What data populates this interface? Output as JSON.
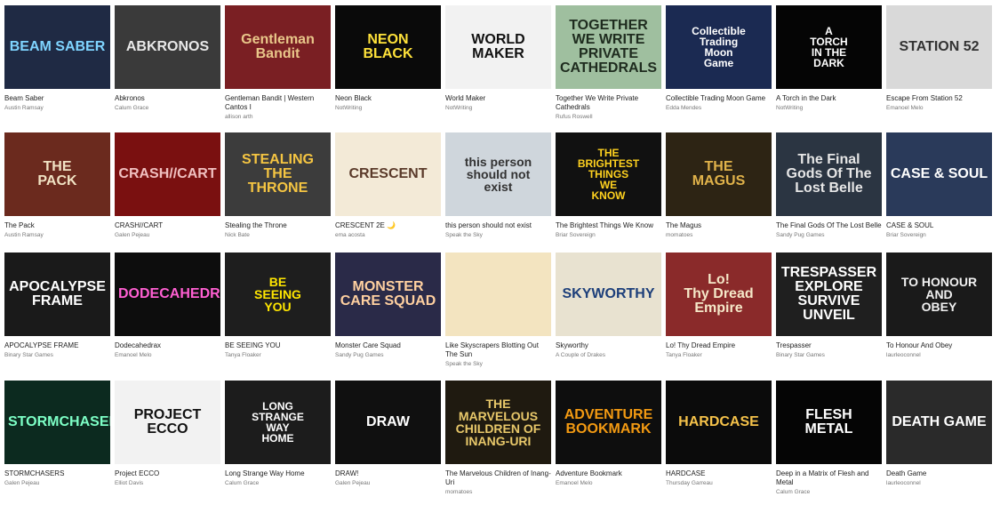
{
  "games": [
    {
      "title": "Beam Saber",
      "author": "Austin Ramsay",
      "art": "BEAM SABER",
      "bg": "#1f2a44",
      "fg": "#7fd4ff"
    },
    {
      "title": "Abkronos",
      "author": "Calum Grace",
      "art": "ABKRONOS",
      "bg": "#3a3a3a",
      "fg": "#e8e8e8"
    },
    {
      "title": "Gentleman Bandit | Western Cantos I",
      "author": "allison arth",
      "art": "Gentleman\nBandit",
      "bg": "#7a1f23",
      "fg": "#e9c78a"
    },
    {
      "title": "Neon Black",
      "author": "NotWriting",
      "art": "NEON\nBLACK",
      "bg": "#0a0a0a",
      "fg": "#ffe23a"
    },
    {
      "title": "World Maker",
      "author": "NotWriting",
      "art": "WORLD\nMAKER",
      "bg": "#f2f2f2",
      "fg": "#111111"
    },
    {
      "title": "Together We Write Private Cathedrals",
      "author": "Rufus Roswell",
      "art": "TOGETHER WE WRITE\nPRIVATE CATHEDRALS",
      "bg": "#9fbf9f",
      "fg": "#1e2b1e"
    },
    {
      "title": "Collectible Trading Moon Game",
      "author": "Edda Mendes",
      "art": "Collectible\nTrading\nMoon\nGame",
      "bg": "#1b2a52",
      "fg": "#ffffff"
    },
    {
      "title": "A Torch in the Dark",
      "author": "NotWriting",
      "art": "A\nTORCH\nIN THE\nDARK",
      "bg": "#050505",
      "fg": "#ffffff"
    },
    {
      "title": "Escape From Station 52",
      "author": "Emanoel Melo",
      "art": "STATION 52",
      "bg": "#d9d9d9",
      "fg": "#333333"
    },
    {
      "title": "The Pack",
      "author": "Austin Ramsay",
      "art": "THE\nPACK",
      "bg": "#6b2a1e",
      "fg": "#f1e3c4"
    },
    {
      "title": "CRASH//CART",
      "author": "Galen Pejeau",
      "art": "CRASH//CART",
      "bg": "#7a1010",
      "fg": "#f0c0c0"
    },
    {
      "title": "Stealing the Throne",
      "author": "Nick Bate",
      "art": "STEALING THE\nTHRONE",
      "bg": "#3c3c3c",
      "fg": "#f5c542"
    },
    {
      "title": "CRESCENT 2E 🌙",
      "author": "ema acosta",
      "art": "CRESCENT",
      "bg": "#f3ead7",
      "fg": "#5a3a2a"
    },
    {
      "title": "this person should not exist",
      "author": "Speak the Sky",
      "art": "this person\nshould not\nexist",
      "bg": "#cfd6dc",
      "fg": "#333333"
    },
    {
      "title": "The Brightest Things We Know",
      "author": "Briar Sovereign",
      "art": "THE\nBRIGHTEST\nTHINGS\nWE\nKNOW",
      "bg": "#111111",
      "fg": "#ffd21f"
    },
    {
      "title": "The Magus",
      "author": "momatoes",
      "art": "THE\nMAGUS",
      "bg": "#2d2414",
      "fg": "#e0b24a"
    },
    {
      "title": "The Final Gods Of The Lost Belle",
      "author": "Sandy Pug Games",
      "art": "The Final Gods Of The Lost Belle",
      "bg": "#2b3542",
      "fg": "#e6e6e6"
    },
    {
      "title": "CASE & SOUL",
      "author": "Briar Sovereign",
      "art": "CASE & SOUL",
      "bg": "#2a3a5a",
      "fg": "#ffffff"
    },
    {
      "title": "APOCALYPSE FRAME",
      "author": "Binary Star Games",
      "art": "APOCALYPSE\nFRAME",
      "bg": "#1a1a1a",
      "fg": "#ffffff"
    },
    {
      "title": "Dodecahedrax",
      "author": "Emanoel Melo",
      "art": "DODECAHEDRAX",
      "bg": "#0d0d0d",
      "fg": "#ff5fd2"
    },
    {
      "title": "BE SEEING YOU",
      "author": "Tanya Floaker",
      "art": "BE\nSEEING\nYOU",
      "bg": "#1e1e1e",
      "fg": "#ffe600"
    },
    {
      "title": "Monster Care Squad",
      "author": "Sandy Pug Games",
      "art": "MONSTER CARE SQUAD",
      "bg": "#2a2a48",
      "fg": "#ffd0a0"
    },
    {
      "title": "Like Skyscrapers Blotting Out The Sun",
      "author": "Speak the Sky",
      "art": "",
      "bg": "#f3e4c0",
      "fg": "#b3201e"
    },
    {
      "title": "Skyworthy",
      "author": "A Couple of Drakes",
      "art": "SKYWORTHY",
      "bg": "#e8e2d0",
      "fg": "#1d3f7a"
    },
    {
      "title": "Lo! Thy Dread Empire",
      "author": "Tanya Floaker",
      "art": "Lo!\nThy Dread Empire",
      "bg": "#8a2a2a",
      "fg": "#f5e8c8"
    },
    {
      "title": "Trespasser",
      "author": "Binary Star Games",
      "art": "TRESPASSER\nEXPLORE  SURVIVE  UNVEIL",
      "bg": "#1f1f1f",
      "fg": "#ffffff"
    },
    {
      "title": "To Honour And Obey",
      "author": "laurleoconnel",
      "art": "TO HONOUR\nAND\nOBEY",
      "bg": "#1a1a1a",
      "fg": "#f0f0f0"
    },
    {
      "title": "STORMCHASERS",
      "author": "Galen Pejeau",
      "art": "STORMCHASERS",
      "bg": "#0c2a1f",
      "fg": "#7dffc6"
    },
    {
      "title": "Project ECCO",
      "author": "Elliot Davis",
      "art": "PROJECT\nECCO",
      "bg": "#f2f2f2",
      "fg": "#111111"
    },
    {
      "title": "Long Strange Way Home",
      "author": "Calum Grace",
      "art": "LONG\nSTRANGE\nWAY\nHOME",
      "bg": "#1c1c1c",
      "fg": "#ffffff"
    },
    {
      "title": "DRAW!",
      "author": "Galen Pejeau",
      "art": "DRAW",
      "bg": "#101010",
      "fg": "#ffffff"
    },
    {
      "title": "The Marvelous Children of Inang-Uri",
      "author": "momatoes",
      "art": "THE MARVELOUS\nCHILDREN OF\nINANG-URI",
      "bg": "#1f1a10",
      "fg": "#e8c86a"
    },
    {
      "title": "Adventure Bookmark",
      "author": "Emanoel Melo",
      "art": "ADVENTURE\nBOOKMARK",
      "bg": "#0e0e0e",
      "fg": "#f39a12"
    },
    {
      "title": "HARDCASE",
      "author": "Thursday Garreau",
      "art": "HARDCASE",
      "bg": "#0b0b0b",
      "fg": "#f5c24a"
    },
    {
      "title": "Deep in a Matrix of Flesh and Metal",
      "author": "Calum Grace",
      "art": "FLESH\nMETAL",
      "bg": "#050505",
      "fg": "#ffffff"
    },
    {
      "title": "Death Game",
      "author": "laurleoconnel",
      "art": "DEATH GAME",
      "bg": "#2a2a2a",
      "fg": "#ffffff"
    }
  ]
}
